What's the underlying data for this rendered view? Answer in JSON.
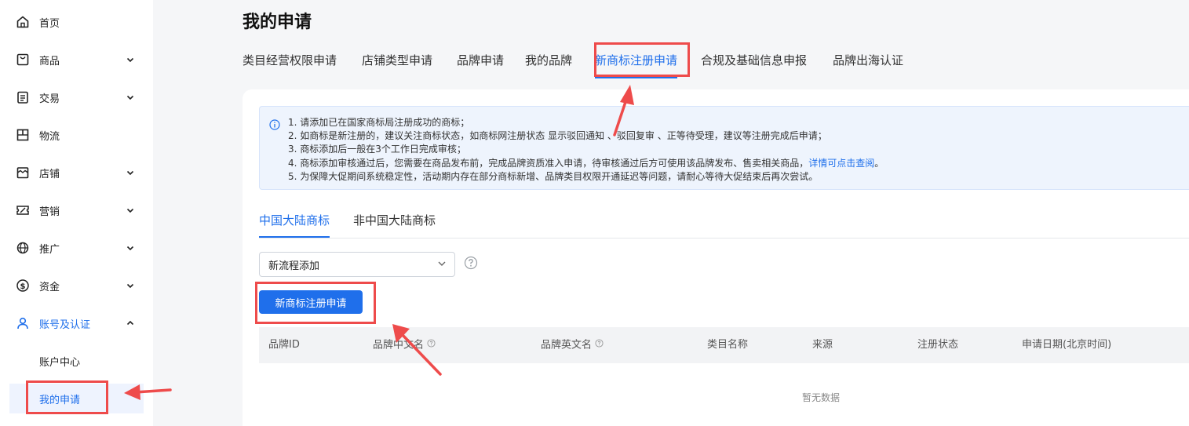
{
  "sidebar": {
    "items": [
      {
        "label": "首页",
        "icon": "home-icon"
      },
      {
        "label": "商品",
        "icon": "product-bag-icon"
      },
      {
        "label": "交易",
        "icon": "clipboard-icon"
      },
      {
        "label": "物流",
        "icon": "box-icon"
      },
      {
        "label": "店铺",
        "icon": "store-icon"
      },
      {
        "label": "营销",
        "icon": "ticket-icon"
      },
      {
        "label": "推广",
        "icon": "globe-ad-icon"
      },
      {
        "label": "资金",
        "icon": "dollar-icon"
      },
      {
        "label": "账号及认证",
        "icon": "user-icon"
      }
    ],
    "subitems": [
      {
        "label": "账户中心"
      },
      {
        "label": "我的申请"
      }
    ]
  },
  "page": {
    "title": "我的申请"
  },
  "top_tabs": [
    "类目经营权限申请",
    "店铺类型申请",
    "品牌申请",
    "我的品牌",
    "新商标注册申请",
    "合规及基础信息申报",
    "品牌出海认证"
  ],
  "notice": {
    "line1": "1. 请添加已在国家商标局注册成功的商标；",
    "line2": "2. 如商标是新注册的，建议关注商标状态，如商标网注册状态 显示驳回通知 、驳回复审 、正等待受理，建议等注册完成后申请；",
    "line3": "3. 商标添加后一般在3个工作日完成审核；",
    "line4": "4. 商标添加审核通过后，您需要在商品发布前，完成品牌资质准入申请，待审核通过后方可使用该品牌发布、售卖相关商品，",
    "line4_link": "详情可点击查阅",
    "line4_end": "。",
    "line5": "5. 为保障大促期间系统稳定性，活动期内存在部分商标新增、品牌类目权限开通延迟等问题，请耐心等待大促结束后再次尝试。"
  },
  "sub_tabs": [
    "中国大陆商标",
    "非中国大陆商标"
  ],
  "flow_select": {
    "value": "新流程添加"
  },
  "primary_button": {
    "label": "新商标注册申请"
  },
  "table": {
    "columns": [
      "品牌ID",
      "品牌中文名",
      "品牌英文名",
      "类目名称",
      "来源",
      "注册状态",
      "申请日期(北京时间)"
    ],
    "empty_text": "暂无数据"
  },
  "colors": {
    "accent": "#1f6feb",
    "annotation": "#ee4b4b"
  }
}
